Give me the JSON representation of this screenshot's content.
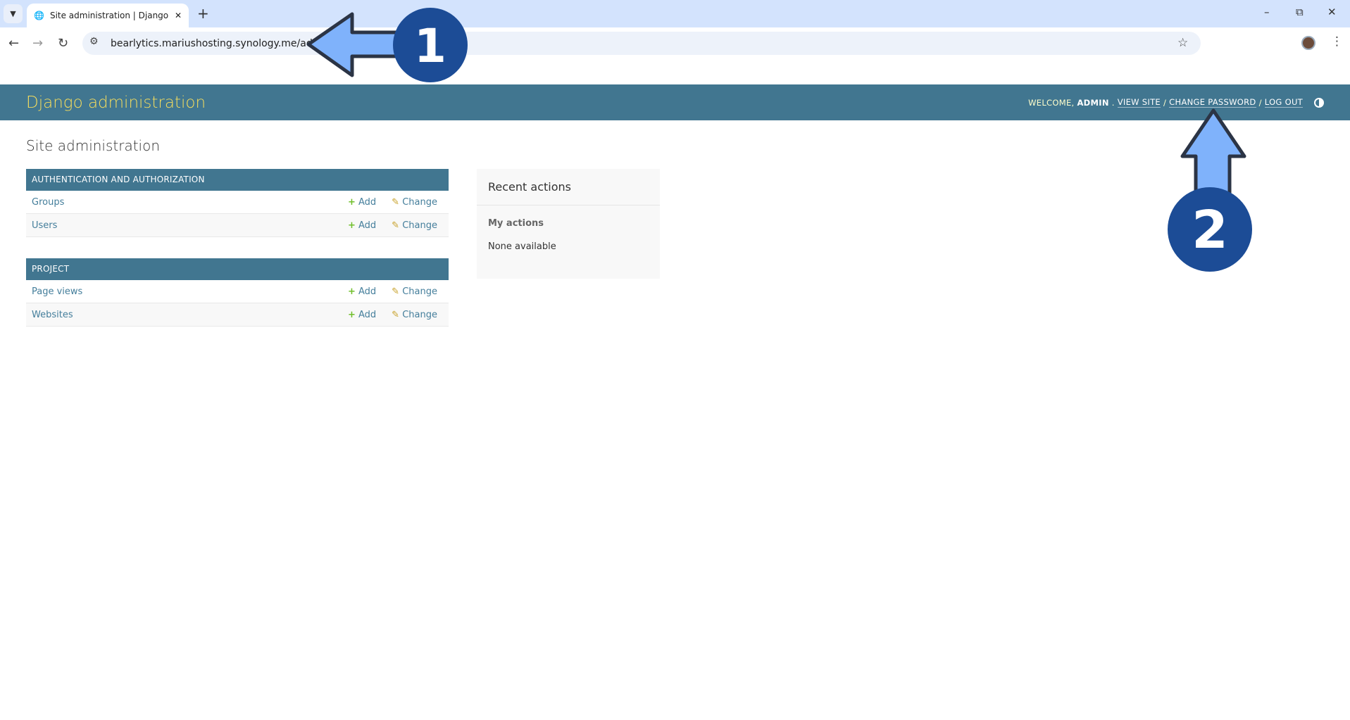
{
  "browser": {
    "tab_title": "Site administration | Django site admin",
    "url": "bearlytics.mariushosting.synology.me/admin/"
  },
  "header": {
    "brand": "Django administration",
    "welcome": "WELCOME,",
    "user": "ADMIN",
    "view_site": "VIEW SITE",
    "change_password": "CHANGE PASSWORD",
    "log_out": "LOG OUT",
    "sep": "/"
  },
  "page_title": "Site administration",
  "modules": [
    {
      "caption": "AUTHENTICATION AND AUTHORIZATION",
      "rows": [
        {
          "name": "Groups"
        },
        {
          "name": "Users"
        }
      ]
    },
    {
      "caption": "PROJECT",
      "rows": [
        {
          "name": "Page views"
        },
        {
          "name": "Websites"
        }
      ]
    }
  ],
  "actions": {
    "add": "Add",
    "change": "Change"
  },
  "recent": {
    "title": "Recent actions",
    "subtitle": "My actions",
    "empty": "None available"
  },
  "annotations": {
    "one": "1",
    "two": "2",
    "arrow_color": "#7fb2fb",
    "badge_color": "#1c4c96"
  }
}
